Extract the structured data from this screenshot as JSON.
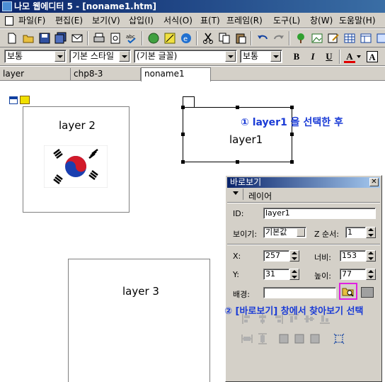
{
  "window": {
    "title": "나모 웹에디터 5 - [noname1.htm]"
  },
  "menu": [
    {
      "label": "파일(F)"
    },
    {
      "label": "편집(E)"
    },
    {
      "label": "보기(V)"
    },
    {
      "label": "삽입(I)"
    },
    {
      "label": "서식(O)"
    },
    {
      "label": "표(T)"
    },
    {
      "label": "프레임(R)"
    },
    {
      "label": "도구(L)"
    },
    {
      "label": "창(W)"
    },
    {
      "label": "도움말(H)"
    }
  ],
  "format": {
    "paragraph_style": "보통",
    "style": "기본 스타일",
    "font": "(기본 글꼴)",
    "size": "보통",
    "bold_label": "B",
    "italic_label": "I",
    "underline_label": "U",
    "font_color_label": "A",
    "highlight_label": "A"
  },
  "doc_tabs": [
    {
      "label": "layer",
      "active": false
    },
    {
      "label": "chp8-3",
      "active": false
    },
    {
      "label": "noname1",
      "active": true
    }
  ],
  "canvas": {
    "layer2": {
      "label": "layer 2",
      "image": "korean-flag"
    },
    "layer1": {
      "label": "layer1",
      "selected": true
    },
    "layer3": {
      "label": "layer 3"
    }
  },
  "annotations": {
    "step1": "① layer1 을 선택한 후",
    "step2": "② [바로보기] 창에서 찾아보기 선택"
  },
  "panel": {
    "title": "바로보기",
    "section": "레이어",
    "id_label": "ID:",
    "id_value": "layer1",
    "visibility_label": "보이기:",
    "visibility_value": "기본값",
    "z_label": "Z 순서:",
    "z_value": "1",
    "x_label": "X:",
    "x_value": "257",
    "width_label": "너비:",
    "width_value": "153",
    "y_label": "Y:",
    "y_value": "31",
    "height_label": "높이:",
    "height_value": "77",
    "background_label": "배경:",
    "background_value": ""
  },
  "colors": {
    "titlebar": "#0a246a",
    "chrome": "#d4d0c8",
    "callout_text": "#1a3bd6",
    "browse_highlight": "#e020e0"
  }
}
